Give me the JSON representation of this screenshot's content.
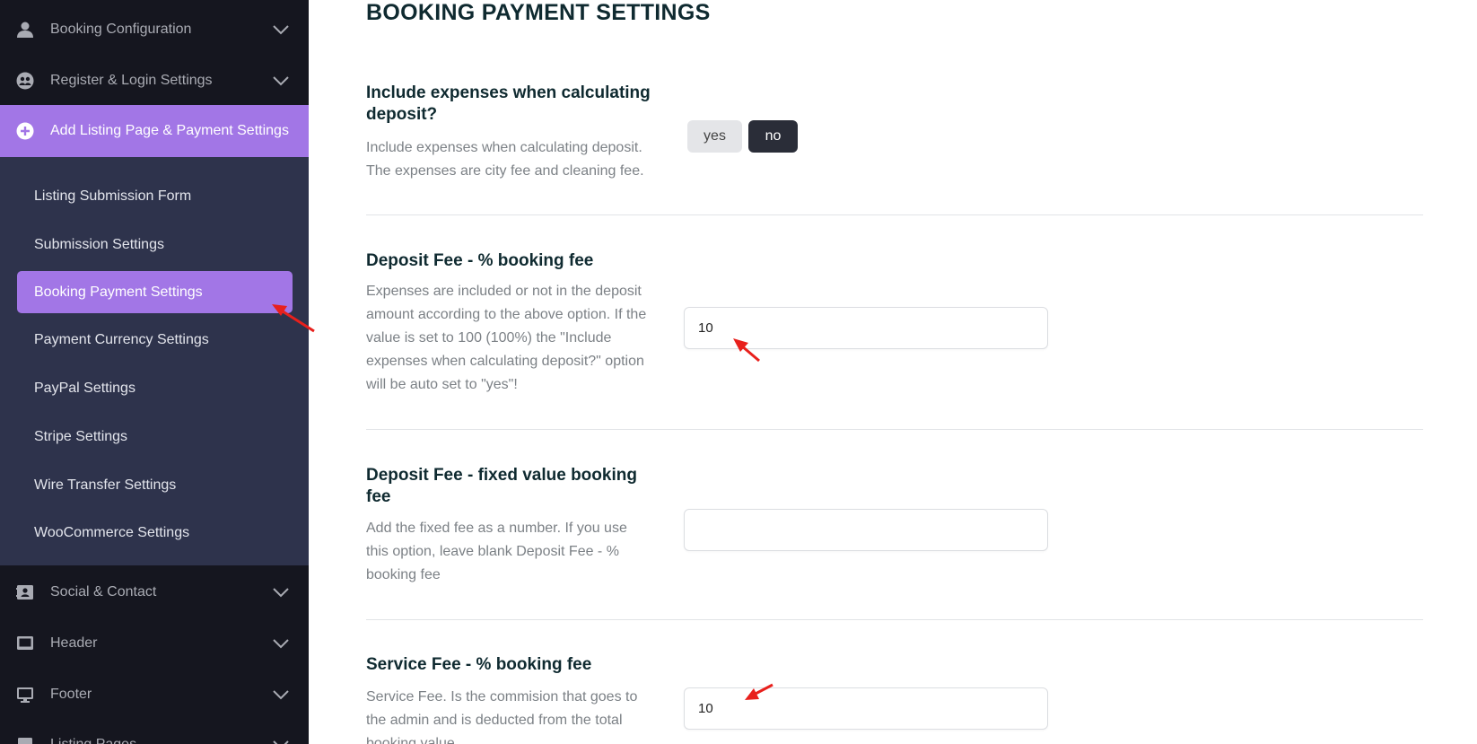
{
  "sidebar": {
    "top_items": [
      {
        "label": "Booking Configuration",
        "icon": "user-icon"
      },
      {
        "label": "Register & Login Settings",
        "icon": "users-icon"
      },
      {
        "label": "Add Listing Page & Payment Settings",
        "icon": "plus-circle-icon"
      }
    ],
    "sub_items": [
      {
        "label": "Listing Submission Form"
      },
      {
        "label": "Submission Settings"
      },
      {
        "label": "Booking Payment Settings"
      },
      {
        "label": "Payment Currency Settings"
      },
      {
        "label": "PayPal Settings"
      },
      {
        "label": "Stripe Settings"
      },
      {
        "label": "Wire Transfer Settings"
      },
      {
        "label": "WooCommerce Settings"
      }
    ],
    "bottom_items": [
      {
        "label": "Social & Contact",
        "icon": "contact-card-icon"
      },
      {
        "label": "Header",
        "icon": "laptop-icon"
      },
      {
        "label": "Footer",
        "icon": "monitor-icon"
      },
      {
        "label": "Listing Pages",
        "icon": "page-icon"
      }
    ],
    "colors": {
      "bg": "#15161f",
      "submenu_bg": "#2e334c",
      "accent": "#a276e6"
    }
  },
  "main": {
    "title": "BOOKING PAYMENT SETTINGS",
    "sections": [
      {
        "title": "Include expenses when calculating deposit?",
        "description": "Include expenses when calculating deposit. The expenses are city fee and cleaning fee.",
        "control": {
          "type": "toggle",
          "options": [
            "yes",
            "no"
          ],
          "selected": "no"
        }
      },
      {
        "title": "Deposit Fee - % booking fee",
        "description": "Expenses are included or not in the deposit amount according to the above option. If the value is set to 100 (100%) the \"Include expenses when calculating deposit?\" option will be auto set to \"yes\"!",
        "control": {
          "type": "input",
          "value": "10"
        }
      },
      {
        "title": "Deposit Fee - fixed value booking fee",
        "description": "Add the fixed fee as a number. If you use this option, leave blank Deposit Fee - % booking fee",
        "control": {
          "type": "input",
          "value": ""
        }
      },
      {
        "title": "Service Fee - % booking fee",
        "description": "Service Fee. Is the commision that goes to the admin and is deducted from the total booking value.",
        "control": {
          "type": "input",
          "value": "10"
        }
      }
    ]
  },
  "annotations": {
    "arrow_color": "#e8201c"
  }
}
